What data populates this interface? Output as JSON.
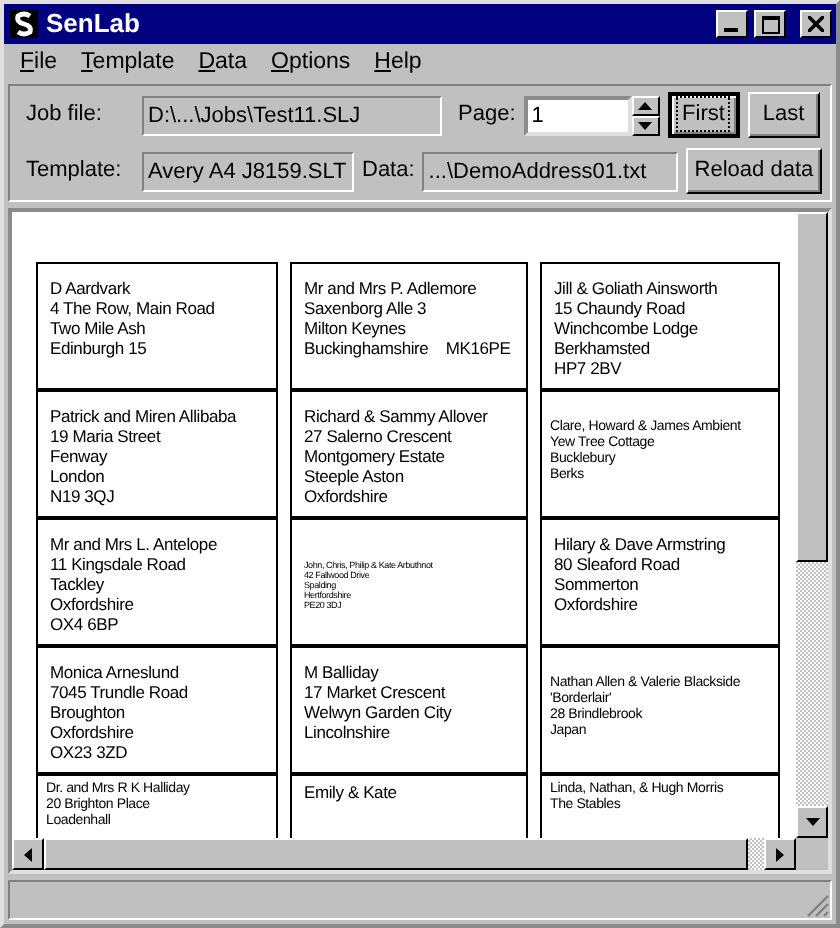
{
  "window": {
    "title": "SenLab"
  },
  "menu": [
    {
      "label": "File"
    },
    {
      "label": "Template"
    },
    {
      "label": "Data"
    },
    {
      "label": "Options"
    },
    {
      "label": "Help"
    }
  ],
  "job_file": {
    "label": "Job file:",
    "value": "D:\\...\\Jobs\\Test11.SLJ"
  },
  "page": {
    "label": "Page:",
    "value": "1"
  },
  "nav_buttons": [
    {
      "label": "First",
      "focused": true
    },
    {
      "label": "Last",
      "focused": false
    }
  ],
  "template": {
    "label": "Template:",
    "value": "Avery A4 J8159.SLT"
  },
  "data": {
    "label": "Data:",
    "value": "...\\DemoAddress01.txt"
  },
  "reload_button": "Reload data",
  "labels": [
    [
      {
        "kind": "normal",
        "lines": [
          "D Aardvark",
          "4 The Row, Main Road",
          "Two Mile Ash",
          "Edinburgh 15"
        ]
      },
      {
        "kind": "normal",
        "lines": [
          "Mr and Mrs P. Adlemore",
          "Saxenborg Alle 3",
          "Milton Keynes",
          "Buckinghamshire    MK16PE"
        ]
      },
      {
        "kind": "normal",
        "lines": [
          "Jill & Goliath Ainsworth",
          "15 Chaundy Road",
          "Winchcombe Lodge",
          "Berkhamsted",
          "HP7 2BV"
        ]
      }
    ],
    [
      {
        "kind": "normal",
        "lines": [
          "Patrick and Miren Allibaba",
          "19 Maria Street",
          "Fenway",
          "London",
          "N19 3QJ"
        ]
      },
      {
        "kind": "normal",
        "lines": [
          "Richard & Sammy Allover",
          "27 Salerno Crescent",
          "Montgomery Estate",
          "Steeple Aston",
          "Oxfordshire"
        ]
      },
      {
        "kind": "small",
        "lines": [
          "Clare, Howard & James Ambient",
          "Yew Tree Cottage",
          "Bucklebury",
          "Berks"
        ]
      }
    ],
    [
      {
        "kind": "normal",
        "lines": [
          "Mr and Mrs L. Antelope",
          "11 Kingsdale Road",
          "Tackley",
          "Oxfordshire",
          "OX4 6BP"
        ]
      },
      {
        "kind": "tiny",
        "lines": [
          "John, Chris, Philip & Kate Arbuthnot",
          "42 Fallwood Drive",
          "Spalding",
          "Hertfordshire",
          "PE20 3DJ"
        ]
      },
      {
        "kind": "normal",
        "lines": [
          "Hilary & Dave Armstring",
          "80 Sleaford Road",
          "Sommerton",
          "Oxfordshire"
        ]
      }
    ],
    [
      {
        "kind": "normal",
        "lines": [
          "Monica Arneslund",
          "7045 Trundle Road",
          "Broughton",
          "Oxfordshire",
          "OX23 3ZD"
        ]
      },
      {
        "kind": "normal",
        "lines": [
          "M Balliday",
          "17 Market Crescent",
          "Welwyn Garden City",
          "Lincolnshire"
        ]
      },
      {
        "kind": "small",
        "lines": [
          "Nathan Allen & Valerie Blackside",
          "'Borderlair'",
          "28 Brindlebrook",
          "Japan"
        ]
      }
    ],
    [
      {
        "kind": "small",
        "lines": [
          "Dr. and Mrs R K Halliday",
          "20 Brighton Place",
          "Loadenhall"
        ]
      },
      {
        "kind": "normal",
        "lines": [
          "Emily & Kate"
        ]
      },
      {
        "kind": "small",
        "lines": [
          "Linda, Nathan, & Hugh Morris",
          "The Stables"
        ]
      }
    ]
  ]
}
